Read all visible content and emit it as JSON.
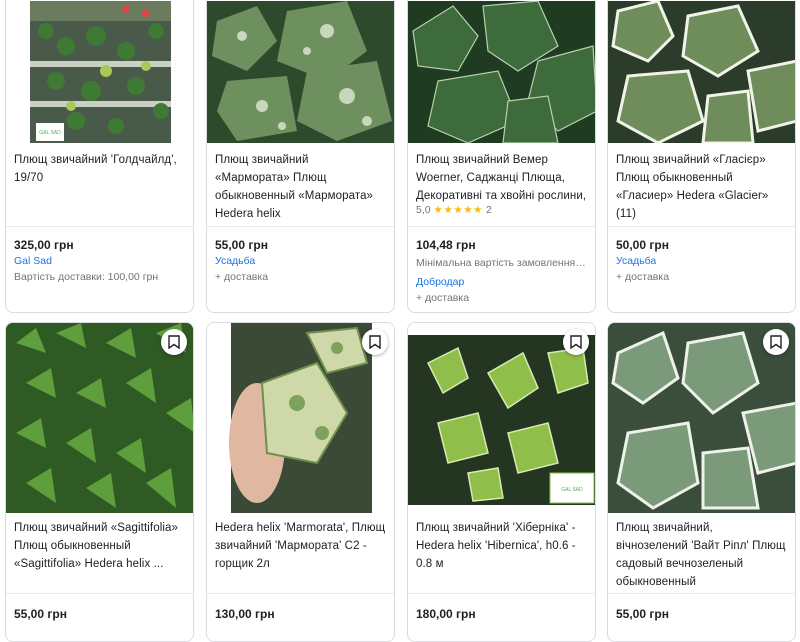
{
  "products": [
    {
      "id": "p1",
      "title": "Плющ звичайний 'Голдчайлд', 19/70",
      "price": "325,00 грн",
      "seller": "Gal Sad",
      "notes": [
        "Вартість доставки: 100,00 грн"
      ],
      "has_logo": true,
      "logo_text": "GAL SAD"
    },
    {
      "id": "p2",
      "title": "Плющ звичайний «Мармората» Плющ обыкновенный «Мармората» Hedera helix",
      "price": "55,00 грн",
      "seller": "Усадьба",
      "notes": [
        "+ доставка"
      ]
    },
    {
      "id": "p3",
      "title": "Плющ звичайний Вемер Woerner, Саджанці Плюща, Декоративні та хвойні рослини,",
      "rating": "5,0",
      "stars": "★★★★★",
      "reviews": "2",
      "price": "104,48 грн",
      "seller": "Добродар",
      "notes": [
        "Мінімальна вартість замовлення: ...",
        "+ доставка"
      ]
    },
    {
      "id": "p4",
      "title": "Плющ звичайний «Гласієр» Плющ обыкновенный «Гласиер» Hedera «Glacier» (11)",
      "price": "50,00 грн",
      "seller": "Усадьба",
      "notes": [
        "+ доставка"
      ]
    },
    {
      "id": "p5",
      "title": "Плющ звичайний «Sagittifolia» Плющ обыкновенный «Sagittifolia» Hedera helix ...",
      "price": "55,00 грн"
    },
    {
      "id": "p6",
      "title": "Hedera helix 'Marmorata', Плющ звичайний 'Мармората' С2 - горщик 2л",
      "price": "130,00 грн"
    },
    {
      "id": "p7",
      "title": "Плющ звичайний 'Хіберніка' - Hedera helix 'Hibernica', h0.6 - 0.8 м",
      "price": "180,00 грн",
      "has_logo": true,
      "logo_text": "GAL SAD"
    },
    {
      "id": "p8",
      "title": "Плющ звичайний, вічнозелений 'Вайт Ріпл' Плющ садовый вечнозеленый обыкновенный",
      "price": "55,00 грн"
    }
  ],
  "icons": {
    "bookmark": "bookmark-icon",
    "star": "star-icon"
  },
  "colors": {
    "link": "#1a73e8",
    "star": "#fbbc04",
    "border": "#dadce0"
  }
}
